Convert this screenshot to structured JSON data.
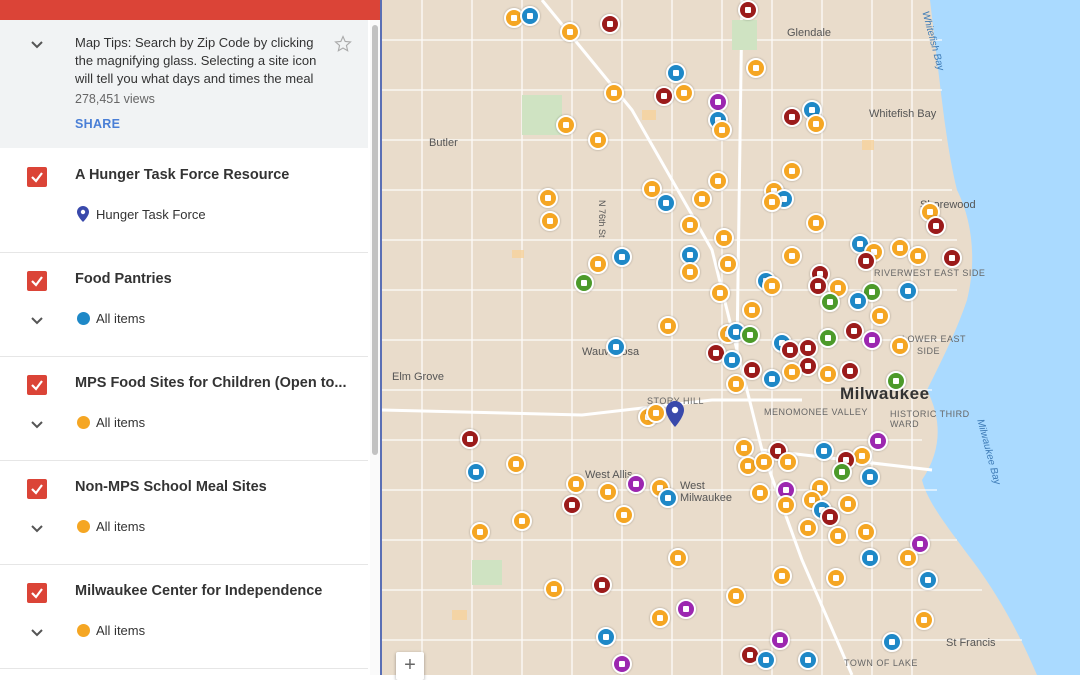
{
  "description": {
    "text": "Map Tips: Search by Zip Code by clicking the magnifying glass. Selecting a site icon will tell you what days and times the meal",
    "views": "278,451 views",
    "share_label": "SHARE"
  },
  "layers": [
    {
      "title": "A Hunger Task Force Resource",
      "sub_label": "Hunger Task Force",
      "icon": "map-pin-icon"
    },
    {
      "title": "Food Pantries",
      "sub_label": "All items",
      "icon": "food-pantry-icon"
    },
    {
      "title": "MPS Food Sites for Children (Open to...",
      "sub_label": "All items",
      "icon": "meal-site-icon"
    },
    {
      "title": "Non-MPS School Meal Sites",
      "sub_label": "All items",
      "icon": "meal-site-icon"
    },
    {
      "title": "Milwaukee Center for Independence",
      "sub_label": "All items",
      "icon": "meal-site-icon"
    }
  ],
  "map": {
    "labels": {
      "glendale": "Glendale",
      "butler": "Butler",
      "whitefish_bay": "Whitefish Bay",
      "whitefish_bay_water": "Whitefish Bay",
      "shorewood": "Shorewood",
      "riverwest": "RIVERWEST",
      "east_side": "EAST SIDE",
      "lower_east_side": "LOWER EAST",
      "side": "SIDE",
      "wauwatosa": "Wauwatosa",
      "elm_grove": "Elm Grove",
      "story_hill": "STORY HILL",
      "menomonee_valley": "MENOMONEE VALLEY",
      "milwaukee": "Milwaukee",
      "historic_third_ward": "HISTORIC THIRD WARD",
      "milwaukee_bay": "Milwaukee Bay",
      "west_allis": "West Allis",
      "west_milwaukee": "West Milwaukee",
      "n76th": "N 76th St",
      "st_francis": "St Francis",
      "town_of_lake": "TOWN OF LAKE"
    },
    "zoom_label": "+"
  }
}
